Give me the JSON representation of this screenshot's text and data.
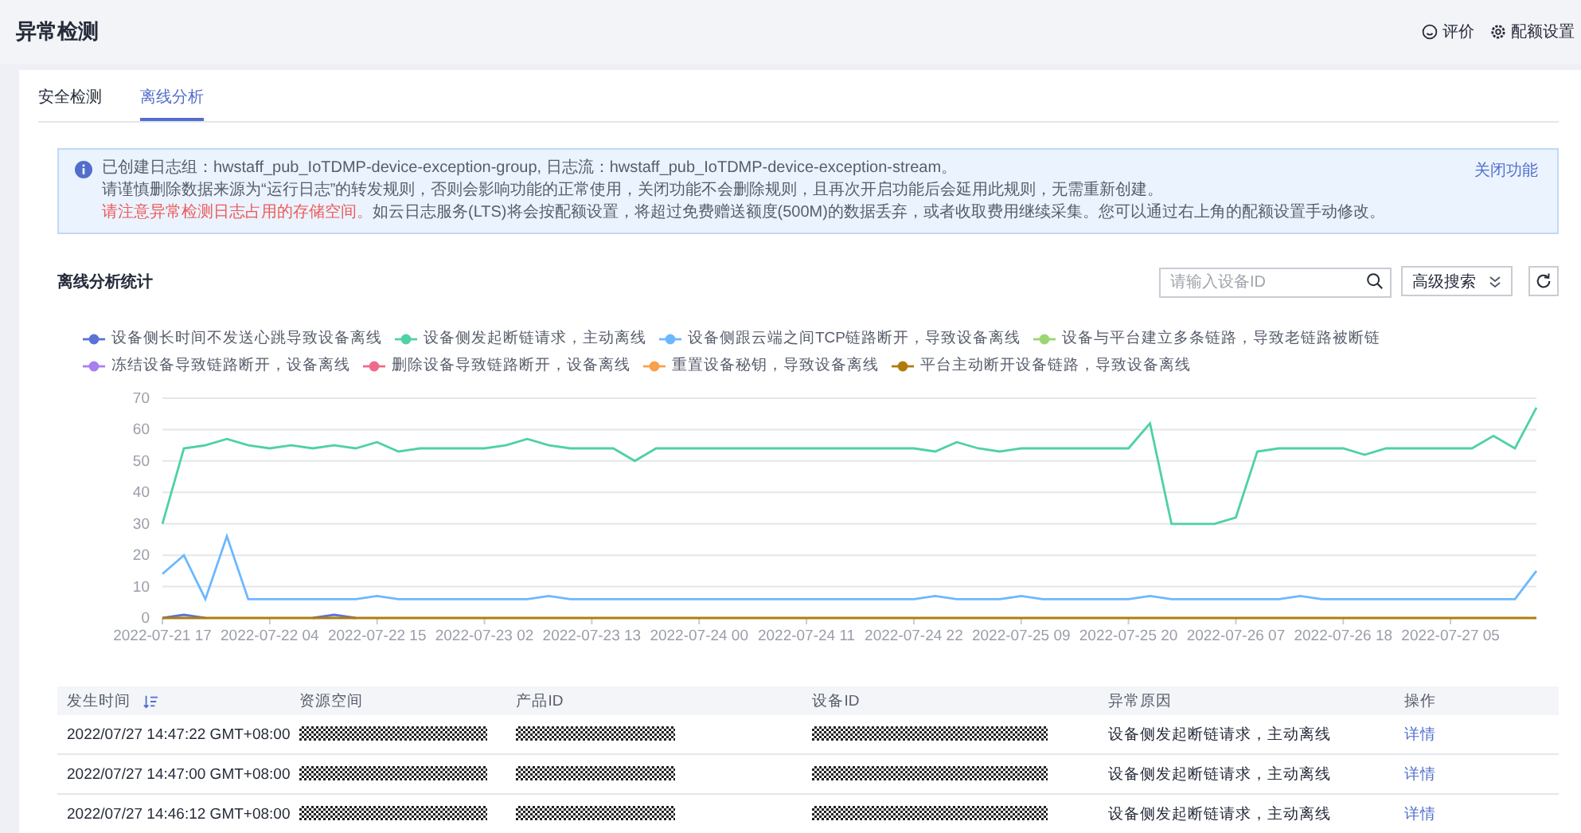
{
  "header": {
    "title": "异常检测",
    "actions": [
      {
        "kind": "rate",
        "label": "评价"
      },
      {
        "kind": "quota",
        "label": "配额设置"
      }
    ]
  },
  "tabs": [
    {
      "label": "安全检测",
      "selected": false
    },
    {
      "label": "离线分析",
      "selected": true
    }
  ],
  "notice": {
    "lines": [
      "已创建日志组：hwstaff_pub_IoTDMP-device-exception-group, 日志流：hwstaff_pub_IoTDMP-device-exception-stream。",
      "请谨慎删除数据来源为“运行日志”的转发规则，否则会影响功能的正常使用，关闭功能不会删除规则，且再次开启功能后会延用此规则，无需重新创建。"
    ],
    "warning": "请注意异常检测日志占用的存储空间。",
    "warning_rest": "如云日志服务(LTS)将会按配额设置，将超过免费赠送额度(500M)的数据丢弃，或者收取费用继续采集。您可以通过右上角的配额设置手动修改。",
    "link": "关闭功能"
  },
  "stats": {
    "title": "离线分析统计",
    "search": {
      "placeholder": "请输入设备ID"
    },
    "advanced_search": "高级搜索",
    "chart_data": {
      "type": "line",
      "grid": true,
      "ylim": [
        0,
        70
      ],
      "categories": [
        "2022-07-21 17",
        null,
        null,
        null,
        null,
        "2022-07-22 04",
        null,
        null,
        null,
        null,
        "2022-07-22 15",
        null,
        null,
        null,
        null,
        "2022-07-23 02",
        null,
        null,
        null,
        null,
        "2022-07-23 13",
        null,
        null,
        null,
        null,
        "2022-07-24 00",
        null,
        null,
        null,
        null,
        "2022-07-24 11",
        null,
        null,
        null,
        null,
        "2022-07-24 22",
        null,
        null,
        null,
        null,
        "2022-07-25 09",
        null,
        null,
        null,
        null,
        "2022-07-25 20",
        null,
        null,
        null,
        null,
        "2022-07-26 07",
        null,
        null,
        null,
        null,
        "2022-07-26 18",
        null,
        null,
        null,
        null,
        "2022-07-27 05",
        null,
        null,
        null,
        null
      ],
      "yticks": [
        0,
        10,
        20,
        30,
        40,
        50,
        60,
        70
      ],
      "series": [
        {
          "name": "设备侧长时间不发送心跳导致设备离线",
          "color": "#5b72d6",
          "values": [
            0,
            1,
            0,
            null,
            null,
            null,
            null,
            0,
            1,
            0,
            null,
            null,
            null,
            null,
            null,
            null,
            null,
            null,
            null,
            null,
            null,
            null,
            null,
            null,
            null,
            null,
            null,
            null,
            null,
            null,
            null,
            null,
            null,
            null,
            null,
            null,
            null,
            null,
            null,
            null,
            null,
            null,
            null,
            null,
            null,
            null,
            null,
            null,
            null,
            null,
            null,
            null,
            null,
            null,
            null,
            null,
            null,
            null,
            null,
            null,
            null,
            null,
            null,
            null,
            null
          ]
        },
        {
          "name": "设备侧发起断链请求，主动离线",
          "color": "#4fd1a5",
          "values": [
            30,
            54,
            55,
            57,
            55,
            54,
            55,
            54,
            55,
            54,
            56,
            53,
            54,
            54,
            54,
            54,
            55,
            57,
            55,
            54,
            54,
            54,
            50,
            54,
            54,
            54,
            54,
            54,
            54,
            54,
            54,
            54,
            54,
            54,
            54,
            54,
            53,
            56,
            54,
            53,
            54,
            54,
            54,
            54,
            54,
            54,
            62,
            30,
            30,
            30,
            32,
            53,
            54,
            54,
            54,
            54,
            52,
            54,
            54,
            54,
            54,
            54,
            58,
            54,
            67
          ]
        },
        {
          "name": "设备侧跟云端之间TCP链路断开，导致设备离线",
          "color": "#6cb8ff",
          "values": [
            14,
            20,
            6,
            26,
            6,
            6,
            6,
            6,
            6,
            6,
            7,
            6,
            6,
            6,
            6,
            6,
            6,
            6,
            7,
            6,
            6,
            6,
            6,
            6,
            6,
            6,
            6,
            6,
            6,
            6,
            6,
            6,
            6,
            6,
            6,
            6,
            7,
            6,
            6,
            6,
            7,
            6,
            6,
            6,
            6,
            6,
            7,
            6,
            6,
            6,
            6,
            6,
            6,
            7,
            6,
            6,
            6,
            6,
            6,
            6,
            6,
            6,
            6,
            6,
            15
          ]
        },
        {
          "name": "设备与平台建立多条链路，导致老链路被断链",
          "color": "#9bd672",
          "values": [
            null,
            null,
            null,
            null,
            null,
            null,
            null,
            null,
            null,
            null,
            null,
            null,
            null,
            null,
            null,
            null,
            null,
            null,
            null,
            null,
            null,
            null,
            null,
            null,
            null,
            null,
            null,
            null,
            null,
            null,
            null,
            null,
            null,
            null,
            null,
            null,
            null,
            null,
            null,
            null,
            null,
            null,
            null,
            null,
            null,
            null,
            null,
            null,
            null,
            null,
            null,
            null,
            null,
            null,
            null,
            null,
            null,
            null,
            null,
            null,
            null,
            null,
            null,
            null,
            null
          ]
        },
        {
          "name": "冻结设备导致链路断开，设备离线",
          "color": "#a87ff0",
          "values": [
            null,
            null,
            null,
            null,
            null,
            null,
            null,
            null,
            null,
            null,
            null,
            null,
            null,
            null,
            null,
            null,
            null,
            null,
            null,
            null,
            null,
            null,
            null,
            null,
            null,
            null,
            null,
            null,
            null,
            null,
            null,
            null,
            null,
            null,
            null,
            null,
            null,
            null,
            null,
            null,
            null,
            null,
            null,
            null,
            null,
            null,
            null,
            null,
            null,
            null,
            null,
            null,
            null,
            null,
            null,
            null,
            null,
            null,
            null,
            null,
            null,
            null,
            null,
            null,
            null
          ]
        },
        {
          "name": "删除设备导致链路断开，设备离线",
          "color": "#ee6a8b",
          "values": [
            null,
            null,
            null,
            null,
            null,
            null,
            null,
            null,
            null,
            null,
            null,
            null,
            null,
            null,
            null,
            null,
            null,
            null,
            null,
            null,
            null,
            null,
            null,
            null,
            null,
            null,
            null,
            null,
            null,
            null,
            null,
            null,
            null,
            null,
            null,
            null,
            null,
            null,
            null,
            null,
            null,
            null,
            null,
            null,
            null,
            null,
            null,
            null,
            null,
            null,
            null,
            null,
            null,
            null,
            null,
            null,
            null,
            null,
            null,
            null,
            null,
            null,
            null,
            null,
            null
          ]
        },
        {
          "name": "重置设备秘钥，导致设备离线",
          "color": "#f8a04c",
          "values": [
            null,
            null,
            null,
            null,
            null,
            null,
            null,
            null,
            null,
            null,
            null,
            null,
            null,
            null,
            null,
            null,
            null,
            null,
            null,
            null,
            null,
            null,
            null,
            null,
            null,
            null,
            null,
            null,
            null,
            null,
            null,
            null,
            null,
            null,
            null,
            null,
            null,
            null,
            null,
            null,
            null,
            null,
            null,
            null,
            null,
            null,
            null,
            null,
            null,
            null,
            null,
            null,
            null,
            null,
            null,
            null,
            null,
            null,
            null,
            null,
            null,
            null,
            null,
            null,
            null
          ]
        },
        {
          "name": "平台主动断开设备链路，导致设备离线",
          "color": "#b07c0e",
          "values": [
            0,
            0,
            0,
            0,
            0,
            0,
            0,
            0,
            0,
            0,
            0,
            0,
            0,
            0,
            0,
            0,
            0,
            0,
            0,
            0,
            0,
            0,
            0,
            0,
            0,
            0,
            0,
            0,
            0,
            0,
            0,
            0,
            0,
            0,
            0,
            0,
            0,
            0,
            0,
            0,
            0,
            0,
            0,
            0,
            0,
            0,
            0,
            0,
            0,
            0,
            0,
            0,
            0,
            0,
            0,
            0,
            0,
            0,
            0,
            0,
            0,
            0,
            0,
            0,
            0
          ]
        }
      ]
    }
  },
  "table": {
    "columns": [
      "发生时间",
      "资源空间",
      "产品ID",
      "设备ID",
      "异常原因",
      "操作"
    ],
    "rows": [
      {
        "time": "2022/07/27 14:47:22 GMT+08:00",
        "reason": "设备侧发起断链请求，主动离线",
        "action": "详情"
      },
      {
        "time": "2022/07/27 14:47:00 GMT+08:00",
        "reason": "设备侧发起断链请求，主动离线",
        "action": "详情"
      },
      {
        "time": "2022/07/27 14:46:12 GMT+08:00",
        "reason": "设备侧发起断链请求，主动离线",
        "action": "详情"
      }
    ]
  }
}
